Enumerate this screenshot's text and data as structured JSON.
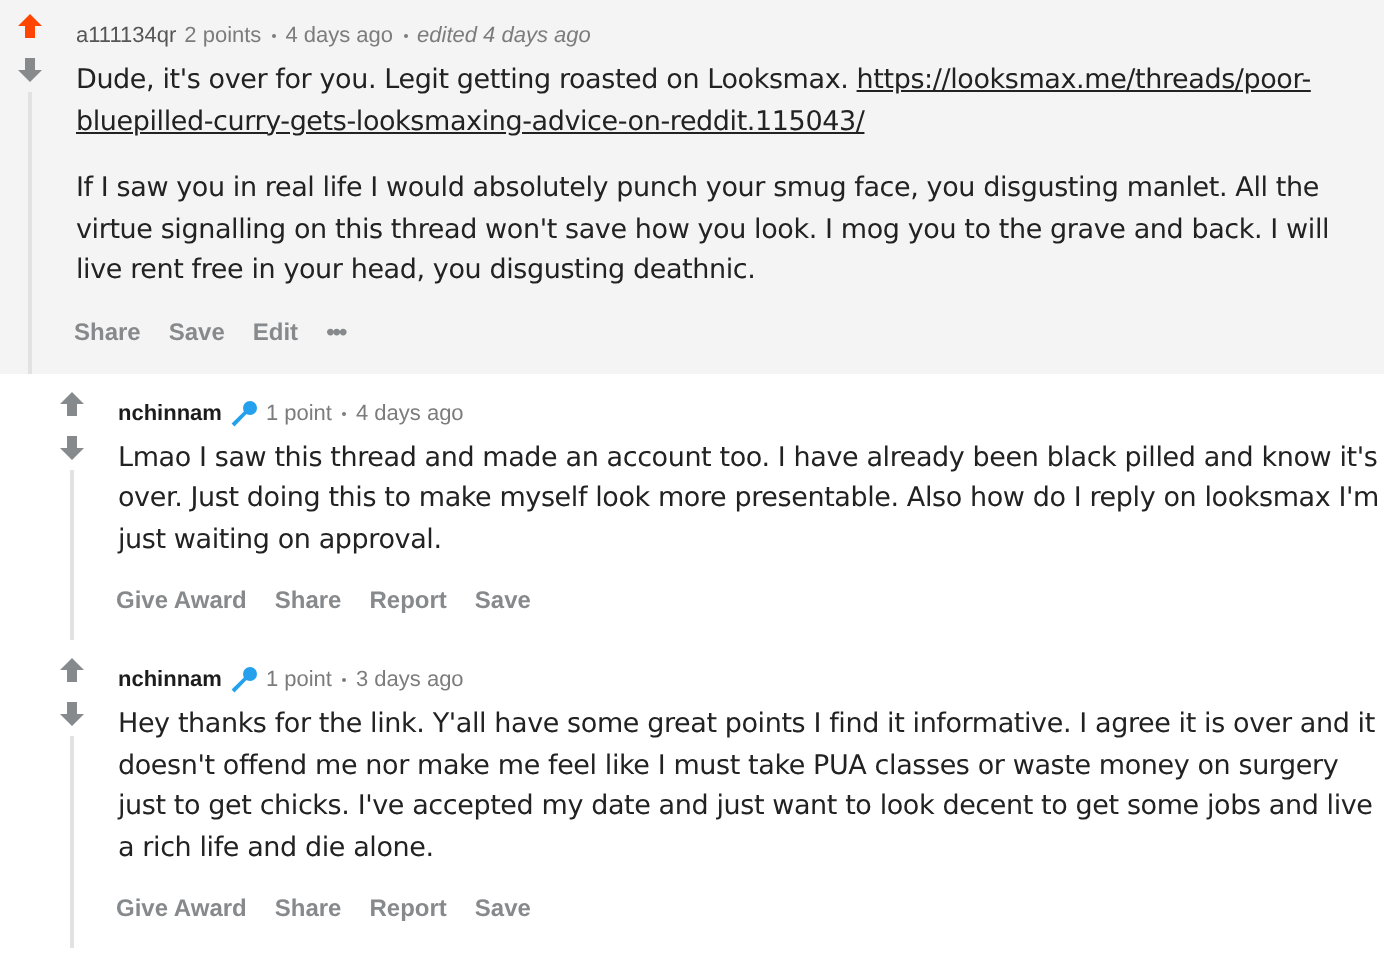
{
  "comments": [
    {
      "author": "a111134qr",
      "has_flair": false,
      "points": "2 points",
      "time": "4 days ago",
      "edited": "edited 4 days ago",
      "upvoted": true,
      "paragraphs": [
        [
          {
            "kind": "text",
            "text": "Dude, it's over for you. Legit getting roasted on Looksmax. "
          },
          {
            "kind": "link",
            "text": "https://looksmax.me/threads/poor-"
          },
          {
            "kind": "link",
            "text": "bluepilled-curry-gets-looksmaxing-advice-on-reddit.115043/"
          }
        ],
        [
          {
            "kind": "text",
            "text": "If I saw you in real life I would absolutely punch your smug face, you disgusting manlet. All the virtue signalling on this thread won't save how you look. I mog you to the grave and back. I will live rent free in your head, you disgusting deathnic."
          }
        ]
      ],
      "actions": [
        {
          "kind": "text",
          "label": "Share"
        },
        {
          "kind": "text",
          "label": "Save"
        },
        {
          "kind": "text",
          "label": "Edit"
        },
        {
          "kind": "more",
          "label": "•••"
        }
      ],
      "replies": [
        {
          "author": "nchinnam",
          "has_flair": true,
          "points": "1 point",
          "time": "4 days ago",
          "upvoted": false,
          "paragraphs": [
            [
              {
                "kind": "text",
                "text": "Lmao I saw this thread and made an account too. I have already been black pilled and know it's over. Just doing this to make myself look more presentable. Also how do I reply on looksmax I'm just waiting on approval."
              }
            ]
          ],
          "actions": [
            {
              "kind": "text",
              "label": "Give Award"
            },
            {
              "kind": "text",
              "label": "Share"
            },
            {
              "kind": "text",
              "label": "Report"
            },
            {
              "kind": "text",
              "label": "Save"
            }
          ]
        },
        {
          "author": "nchinnam",
          "has_flair": true,
          "points": "1 point",
          "time": "3 days ago",
          "upvoted": false,
          "paragraphs": [
            [
              {
                "kind": "text",
                "text": "Hey thanks for the link. Y'all have some great points I find it informative. I agree it is over and it doesn't offend me nor make me feel like I must take PUA classes or waste money on surgery just to get chicks. I've accepted my date and just want to look decent to get some jobs and live a rich life and die alone."
              }
            ]
          ],
          "actions": [
            {
              "kind": "text",
              "label": "Give Award"
            },
            {
              "kind": "text",
              "label": "Share"
            },
            {
              "kind": "text",
              "label": "Report"
            },
            {
              "kind": "text",
              "label": "Save"
            }
          ]
        }
      ]
    }
  ]
}
